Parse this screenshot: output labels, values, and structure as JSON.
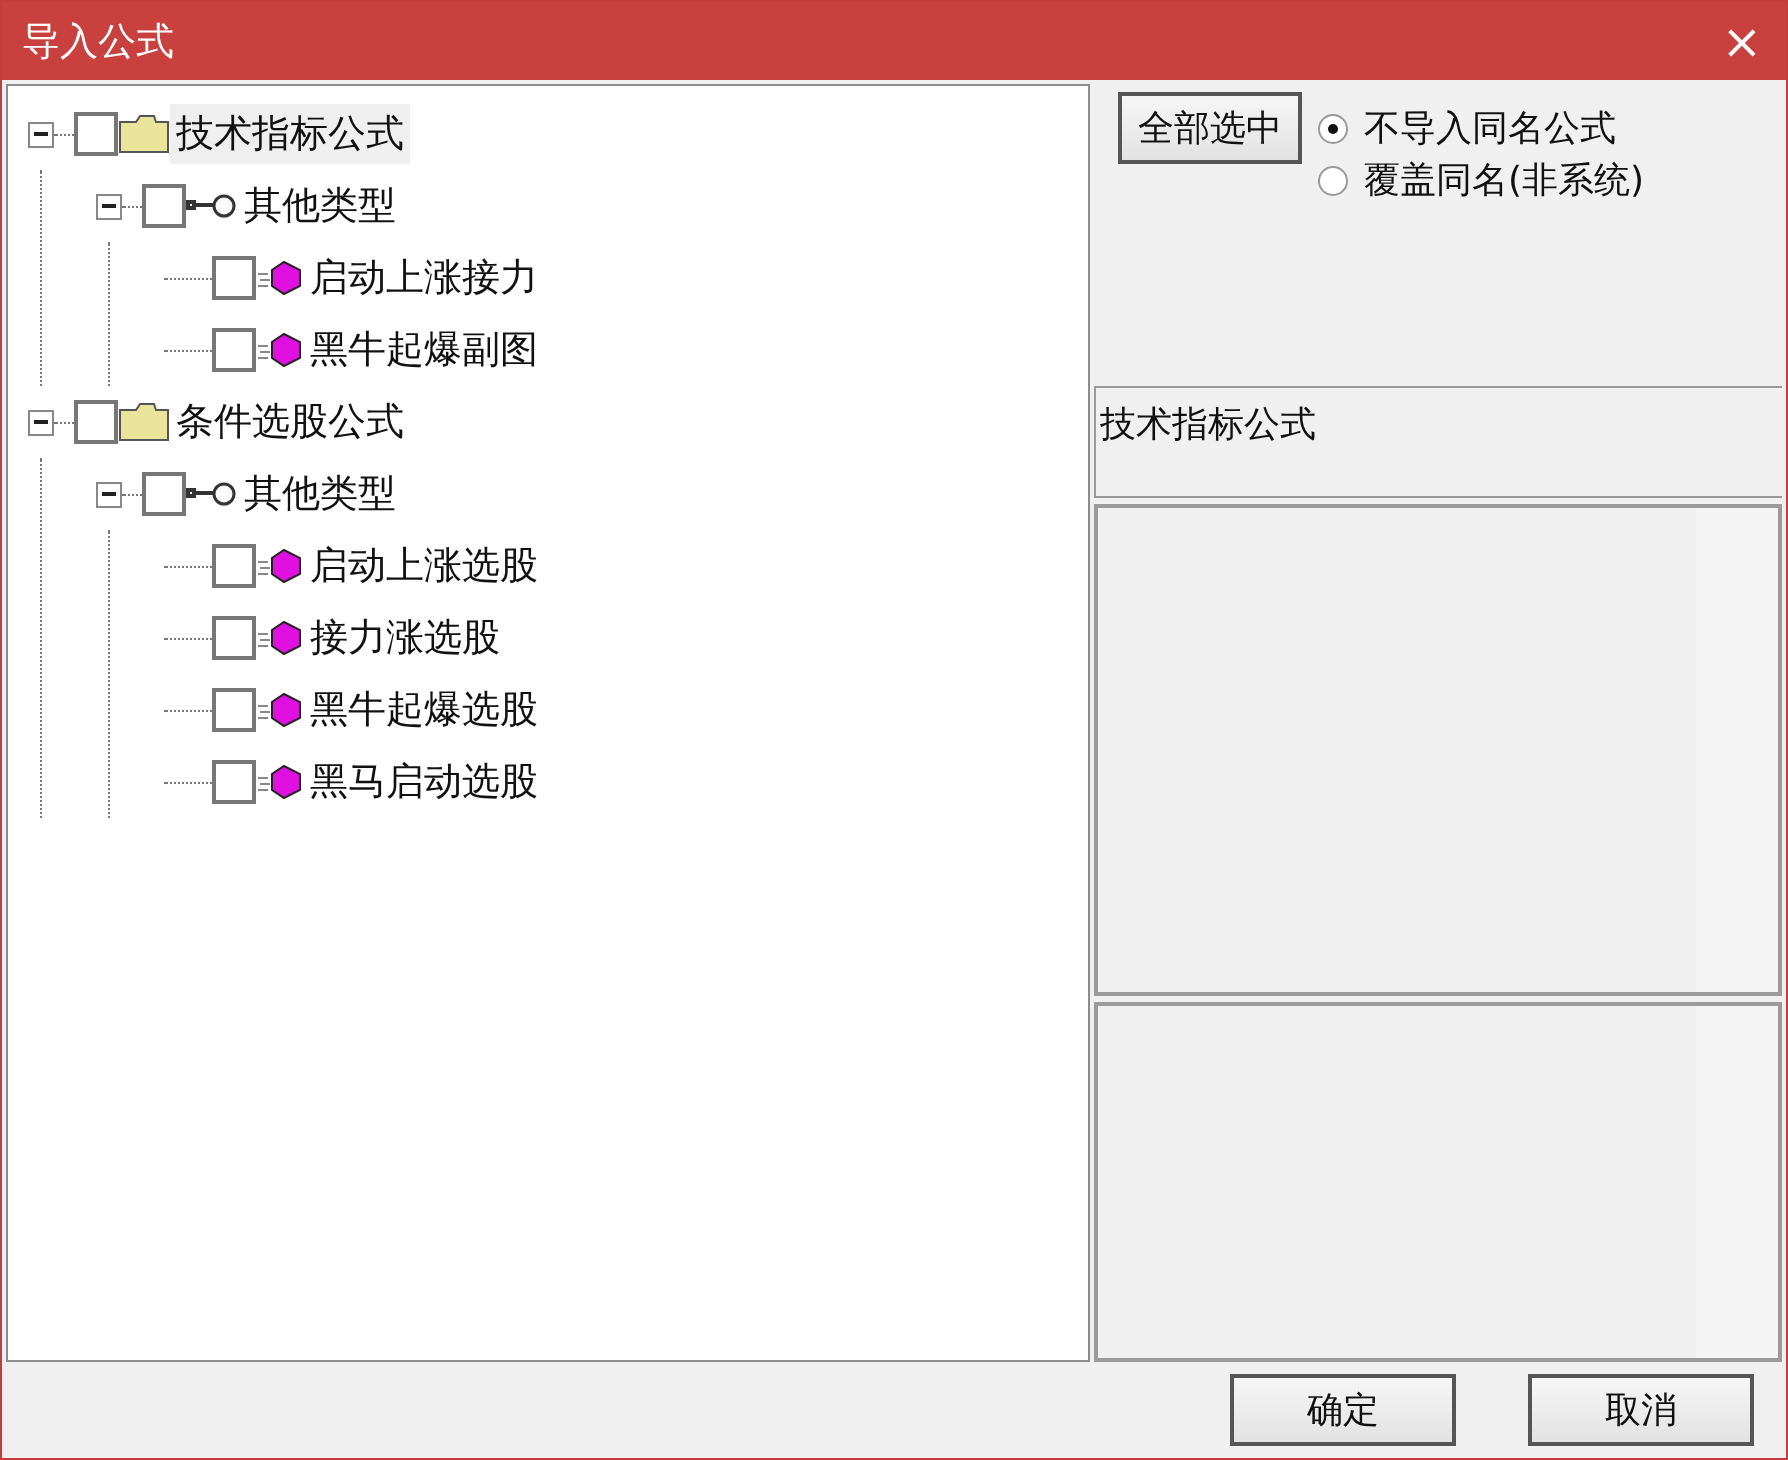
{
  "window": {
    "title": "导入公式",
    "close": "×"
  },
  "tree": [
    {
      "label": "技术指标公式",
      "kind": "folder",
      "checked": false,
      "expanded": true,
      "selected": true,
      "children": [
        {
          "label": "其他类型",
          "kind": "group",
          "checked": false,
          "expanded": true,
          "selected": false,
          "children": [
            {
              "label": "启动上涨接力",
              "kind": "formula",
              "checked": false,
              "selected": false
            },
            {
              "label": "黑牛起爆副图",
              "kind": "formula",
              "checked": false,
              "selected": false
            }
          ]
        }
      ]
    },
    {
      "label": "条件选股公式",
      "kind": "folder",
      "checked": false,
      "expanded": true,
      "selected": false,
      "children": [
        {
          "label": "其他类型",
          "kind": "group",
          "checked": false,
          "expanded": true,
          "selected": false,
          "children": [
            {
              "label": "启动上涨选股",
              "kind": "formula",
              "checked": false,
              "selected": false
            },
            {
              "label": "接力涨选股",
              "kind": "formula",
              "checked": false,
              "selected": false
            },
            {
              "label": "黑牛起爆选股",
              "kind": "formula",
              "checked": false,
              "selected": false
            },
            {
              "label": "黑马启动选股",
              "kind": "formula",
              "checked": false,
              "selected": false
            }
          ]
        }
      ]
    }
  ],
  "select_all_button": "全部选中",
  "import_options": [
    {
      "label": "不导入同名公式",
      "selected": true
    },
    {
      "label": "覆盖同名(非系统)",
      "selected": false
    }
  ],
  "category_field": "技术指标公式",
  "buttons": [
    "确定",
    "取消"
  ]
}
